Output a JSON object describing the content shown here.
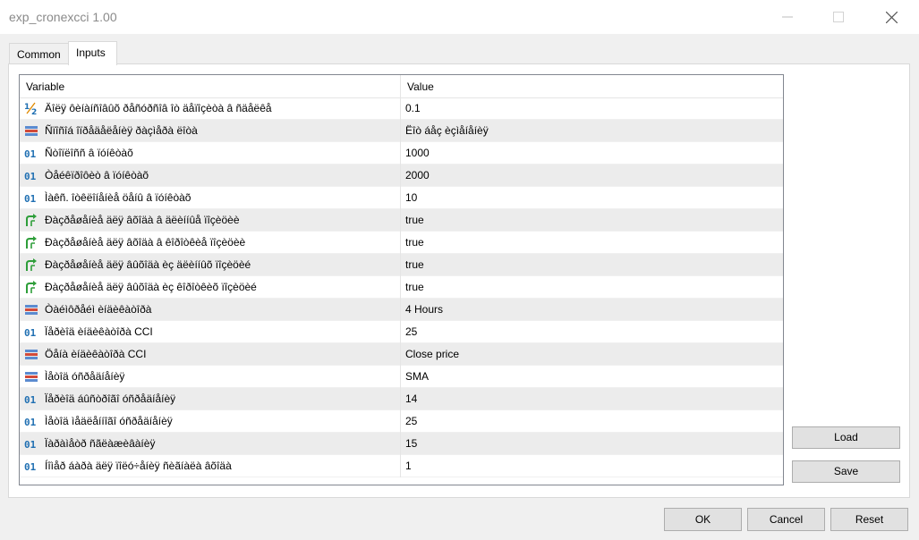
{
  "window": {
    "title": "exp_cronexcci 1.00"
  },
  "tabs": [
    {
      "label": "Common",
      "active": false
    },
    {
      "label": "Inputs",
      "active": true
    }
  ],
  "grid": {
    "headers": {
      "variable": "Variable",
      "value": "Value"
    },
    "rows": [
      {
        "icon": "half-icon",
        "name": "Äîëÿ ôèíàíñîâûõ ðåñóðñîâ îò äåïîçèòà â ñäåëêå",
        "value": "0.1"
      },
      {
        "icon": "enum-icon",
        "name": "Ñïîñîá îïðåäåëåíèÿ ðàçìåðà ëîòà",
        "value": "Ëîò áåç èçìåíåíèÿ"
      },
      {
        "icon": "int-icon",
        "name": "Ñòîïëîññ â ïóíêòàõ",
        "value": "1000"
      },
      {
        "icon": "int-icon",
        "name": "Òåéêïðîôèò â ïóíêòàõ",
        "value": "2000"
      },
      {
        "icon": "int-icon",
        "name": "Ìàêñ. îòêëîíåíèå öåíû â ïóíêòàõ",
        "value": "10"
      },
      {
        "icon": "bool-icon",
        "name": "Ðàçðåøåíèå äëÿ âõîäà â äëèííûå ïîçèöèè",
        "value": "true"
      },
      {
        "icon": "bool-icon",
        "name": "Ðàçðåøåíèå äëÿ âõîäà â êîðîòêèå ïîçèöèè",
        "value": "true"
      },
      {
        "icon": "bool-icon",
        "name": "Ðàçðåøåíèå äëÿ âûõîäà èç äëèííûõ ïîçèöèé",
        "value": "true"
      },
      {
        "icon": "bool-icon",
        "name": "Ðàçðåøåíèå äëÿ âûõîäà èç êîðîòêèõ ïîçèöèé",
        "value": "true"
      },
      {
        "icon": "enum-icon",
        "name": "Òàéìôðåéì èíäèêàòîðà",
        "value": "4 Hours"
      },
      {
        "icon": "int-icon",
        "name": "Ïåðèîä èíäèêàòîðà CCI",
        "value": "25"
      },
      {
        "icon": "enum-icon",
        "name": "Öåíà èíäèêàòîðà CCI",
        "value": "Close price"
      },
      {
        "icon": "enum-icon",
        "name": "Ìåòîä óñðåäíåíèÿ",
        "value": "SMA"
      },
      {
        "icon": "int-icon",
        "name": "Ïåðèîä áûñòðîãî óñðåäíåíèÿ",
        "value": "14"
      },
      {
        "icon": "int-icon",
        "name": "Ìåòîä ìåäëåííîãî óñðåäíåíèÿ",
        "value": "25"
      },
      {
        "icon": "int-icon",
        "name": "Ïàðàìåòð ñãëàæèâàíèÿ",
        "value": "15"
      },
      {
        "icon": "int-icon",
        "name": "Íîìåð áàðà äëÿ ïîëó÷åíèÿ ñèãíàëà âõîäà",
        "value": "1"
      }
    ]
  },
  "side_buttons": {
    "load": "Load",
    "save": "Save"
  },
  "footer_buttons": {
    "ok": "OK",
    "cancel": "Cancel",
    "reset": "Reset"
  }
}
